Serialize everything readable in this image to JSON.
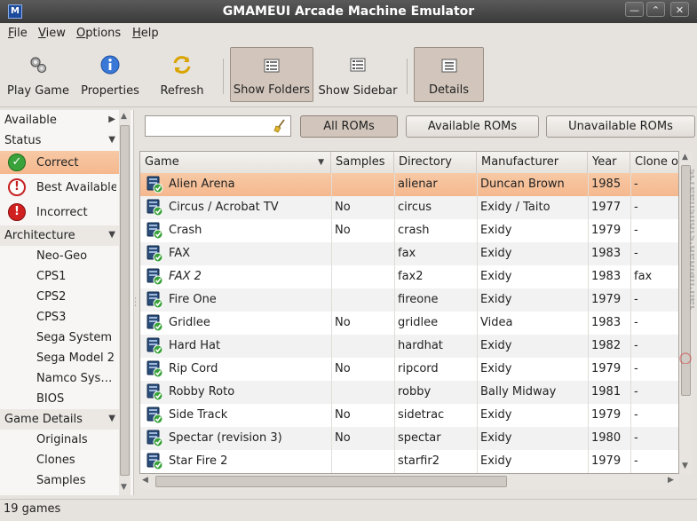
{
  "window": {
    "title": "GMAMEUI Arcade Machine Emulator",
    "app_icon": "M"
  },
  "menu": [
    {
      "label": "File",
      "mnemonic": "F"
    },
    {
      "label": "View",
      "mnemonic": "V"
    },
    {
      "label": "Options",
      "mnemonic": "O"
    },
    {
      "label": "Help",
      "mnemonic": "H"
    }
  ],
  "toolbar": {
    "play": "Play Game",
    "properties": "Properties",
    "refresh": "Refresh",
    "show_folders": "Show Folders",
    "show_sidebar": "Show Sidebar",
    "details": "Details"
  },
  "sidebar": {
    "available": "Available",
    "status_header": "Status",
    "status_items": [
      {
        "label": "Correct",
        "icon": "check-icon"
      },
      {
        "label": "Best Available",
        "icon": "warning-icon"
      },
      {
        "label": "Incorrect",
        "icon": "error-icon"
      }
    ],
    "architecture_header": "Architecture",
    "architecture_items": [
      "Neo-Geo",
      "CPS1",
      "CPS2",
      "CPS3",
      "Sega System",
      "Sega Model 2",
      "Namco System",
      "BIOS"
    ],
    "game_details_header": "Game Details",
    "game_details_items": [
      "Originals",
      "Clones",
      "Samples"
    ]
  },
  "filter": {
    "search_value": "",
    "search_placeholder": "",
    "all_roms": "All ROMs",
    "available_roms": "Available ROMs",
    "unavailable_roms": "Unavailable ROMs"
  },
  "table": {
    "columns": [
      "Game",
      "Samples",
      "Directory",
      "Manufacturer",
      "Year",
      "Clone of"
    ],
    "rows": [
      {
        "game": "Alien Arena",
        "samples": "",
        "directory": "alienar",
        "manufacturer": "Duncan Brown",
        "year": "1985",
        "clone_of": "-"
      },
      {
        "game": "Circus / Acrobat TV",
        "samples": "No",
        "directory": "circus",
        "manufacturer": "Exidy / Taito",
        "year": "1977",
        "clone_of": "-"
      },
      {
        "game": "Crash",
        "samples": "No",
        "directory": "crash",
        "manufacturer": "Exidy",
        "year": "1979",
        "clone_of": "-"
      },
      {
        "game": "FAX",
        "samples": "",
        "directory": "fax",
        "manufacturer": "Exidy",
        "year": "1983",
        "clone_of": "-"
      },
      {
        "game": "FAX 2",
        "samples": "",
        "directory": "fax2",
        "manufacturer": "Exidy",
        "year": "1983",
        "clone_of": "fax"
      },
      {
        "game": "Fire One",
        "samples": "",
        "directory": "fireone",
        "manufacturer": "Exidy",
        "year": "1979",
        "clone_of": "-"
      },
      {
        "game": "Gridlee",
        "samples": "No",
        "directory": "gridlee",
        "manufacturer": "Videa",
        "year": "1983",
        "clone_of": "-"
      },
      {
        "game": "Hard Hat",
        "samples": "",
        "directory": "hardhat",
        "manufacturer": "Exidy",
        "year": "1982",
        "clone_of": "-"
      },
      {
        "game": "Rip Cord",
        "samples": "No",
        "directory": "ripcord",
        "manufacturer": "Exidy",
        "year": "1979",
        "clone_of": "-"
      },
      {
        "game": "Robby Roto",
        "samples": "",
        "directory": "robby",
        "manufacturer": "Bally Midway",
        "year": "1981",
        "clone_of": "-"
      },
      {
        "game": "Side Track",
        "samples": "No",
        "directory": "sidetrac",
        "manufacturer": "Exidy",
        "year": "1979",
        "clone_of": "-"
      },
      {
        "game": "Spectar (revision 3)",
        "samples": "No",
        "directory": "spectar",
        "manufacturer": "Exidy",
        "year": "1980",
        "clone_of": "-"
      },
      {
        "game": "Star Fire 2",
        "samples": "",
        "directory": "starfir2",
        "manufacturer": "Exidy",
        "year": "1979",
        "clone_of": "-"
      }
    ]
  },
  "status": {
    "count": "19 games"
  },
  "watermark": "screenshots.debian.net",
  "colors": {
    "selection": "#f5b88e",
    "pressed": "#d2c6bc",
    "titlebar": "#3a3a3a"
  }
}
